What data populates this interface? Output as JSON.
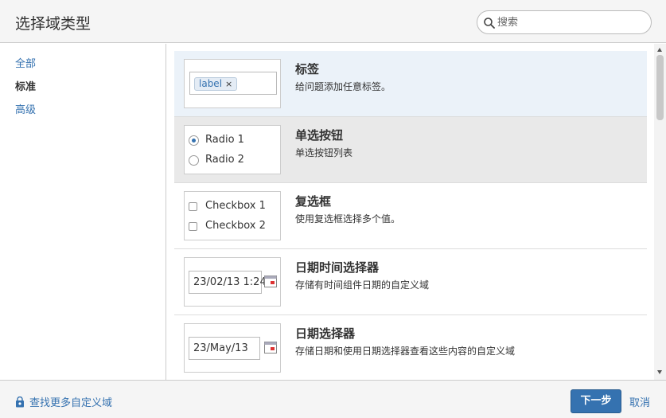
{
  "dialog": {
    "title": "选择域类型"
  },
  "search": {
    "placeholder": "搜索"
  },
  "sidebar": {
    "items": [
      {
        "label": "全部"
      },
      {
        "label": "标准"
      },
      {
        "label": "高级"
      }
    ],
    "active_index": 1
  },
  "fields": [
    {
      "name": "标签",
      "description": "给问题添加任意标签。",
      "preview": {
        "lozenge": "label",
        "remove": "×"
      }
    },
    {
      "name": "单选按钮",
      "description": "单选按钮列表",
      "preview": {
        "options": [
          "Radio 1",
          "Radio 2"
        ]
      }
    },
    {
      "name": "复选框",
      "description": "使用复选框选择多个值。",
      "preview": {
        "options": [
          "Checkbox 1",
          "Checkbox 2"
        ]
      }
    },
    {
      "name": "日期时间选择器",
      "description": "存储有时间组件日期的自定义域",
      "preview": {
        "value": "23/02/13 1:24"
      }
    },
    {
      "name": "日期选择器",
      "description": "存储日期和使用日期选择器查看这些内容的自定义域",
      "preview": {
        "value": "23/May/13"
      }
    }
  ],
  "footer": {
    "more_link": "查找更多自定义域",
    "next_label": "下一步",
    "cancel_label": "取消"
  },
  "colors": {
    "accent": "#3572b0",
    "selected_row": "#ebf2f9",
    "hover_row": "#e9e9e9",
    "chrome": "#f5f5f5"
  }
}
